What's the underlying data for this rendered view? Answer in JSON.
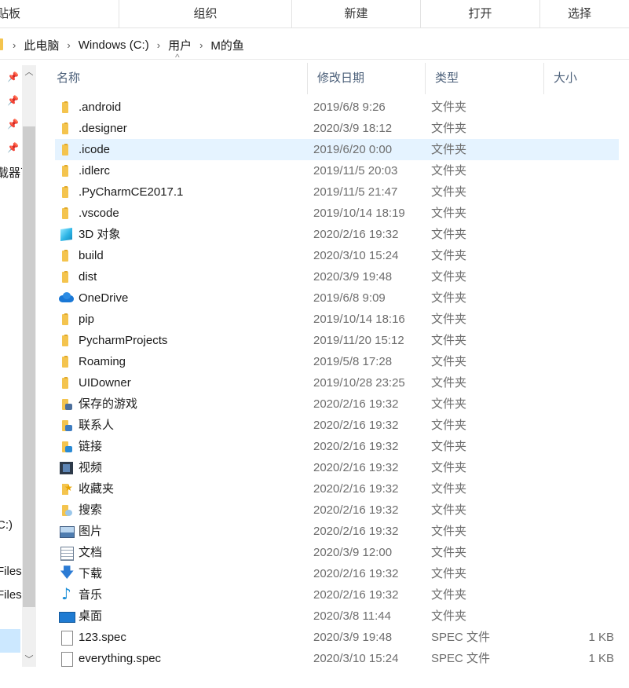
{
  "ribbon": {
    "groups": [
      "贴板",
      "组织",
      "新建",
      "打开",
      "选择"
    ]
  },
  "address": {
    "crumbs": [
      "此电脑",
      "Windows (C:)",
      "用户",
      "M的鱼"
    ]
  },
  "nav": {
    "partial_labels": [
      "载器丁",
      "C:)",
      "Files",
      "Files"
    ]
  },
  "headers": {
    "name": "名称",
    "date": "修改日期",
    "type": "类型",
    "size": "大小"
  },
  "rows": [
    {
      "name": ".android",
      "date": "2019/6/8 9:26",
      "type": "文件夹",
      "size": "",
      "icon": "folder-icon"
    },
    {
      "name": ".designer",
      "date": "2020/3/9 18:12",
      "type": "文件夹",
      "size": "",
      "icon": "folder-icon"
    },
    {
      "name": ".icode",
      "date": "2019/6/20 0:00",
      "type": "文件夹",
      "size": "",
      "icon": "folder-icon"
    },
    {
      "name": ".idlerc",
      "date": "2019/11/5 20:03",
      "type": "文件夹",
      "size": "",
      "icon": "folder-icon"
    },
    {
      "name": ".PyCharmCE2017.1",
      "date": "2019/11/5 21:47",
      "type": "文件夹",
      "size": "",
      "icon": "folder-icon"
    },
    {
      "name": ".vscode",
      "date": "2019/10/14 18:19",
      "type": "文件夹",
      "size": "",
      "icon": "folder-icon"
    },
    {
      "name": "3D 对象",
      "date": "2020/2/16 19:32",
      "type": "文件夹",
      "size": "",
      "icon": "3d-objects-icon"
    },
    {
      "name": "build",
      "date": "2020/3/10 15:24",
      "type": "文件夹",
      "size": "",
      "icon": "folder-icon"
    },
    {
      "name": "dist",
      "date": "2020/3/9 19:48",
      "type": "文件夹",
      "size": "",
      "icon": "folder-icon"
    },
    {
      "name": "OneDrive",
      "date": "2019/6/8 9:09",
      "type": "文件夹",
      "size": "",
      "icon": "onedrive-cloud-icon"
    },
    {
      "name": "pip",
      "date": "2019/10/14 18:16",
      "type": "文件夹",
      "size": "",
      "icon": "folder-icon"
    },
    {
      "name": "PycharmProjects",
      "date": "2019/11/20 15:12",
      "type": "文件夹",
      "size": "",
      "icon": "folder-icon"
    },
    {
      "name": "Roaming",
      "date": "2019/5/8 17:28",
      "type": "文件夹",
      "size": "",
      "icon": "folder-icon"
    },
    {
      "name": "UIDowner",
      "date": "2019/10/28 23:25",
      "type": "文件夹",
      "size": "",
      "icon": "folder-icon"
    },
    {
      "name": "保存的游戏",
      "date": "2020/2/16 19:32",
      "type": "文件夹",
      "size": "",
      "icon": "saved-games-icon"
    },
    {
      "name": "联系人",
      "date": "2020/2/16 19:32",
      "type": "文件夹",
      "size": "",
      "icon": "contacts-icon"
    },
    {
      "name": "链接",
      "date": "2020/2/16 19:32",
      "type": "文件夹",
      "size": "",
      "icon": "links-icon"
    },
    {
      "name": "视频",
      "date": "2020/2/16 19:32",
      "type": "文件夹",
      "size": "",
      "icon": "videos-icon"
    },
    {
      "name": "收藏夹",
      "date": "2020/2/16 19:32",
      "type": "文件夹",
      "size": "",
      "icon": "favorites-icon"
    },
    {
      "name": "搜索",
      "date": "2020/2/16 19:32",
      "type": "文件夹",
      "size": "",
      "icon": "searches-icon"
    },
    {
      "name": "图片",
      "date": "2020/2/16 19:32",
      "type": "文件夹",
      "size": "",
      "icon": "pictures-icon"
    },
    {
      "name": "文档",
      "date": "2020/3/9 12:00",
      "type": "文件夹",
      "size": "",
      "icon": "documents-icon"
    },
    {
      "name": "下载",
      "date": "2020/2/16 19:32",
      "type": "文件夹",
      "size": "",
      "icon": "downloads-icon"
    },
    {
      "name": "音乐",
      "date": "2020/2/16 19:32",
      "type": "文件夹",
      "size": "",
      "icon": "music-icon"
    },
    {
      "name": "桌面",
      "date": "2020/3/8 11:44",
      "type": "文件夹",
      "size": "",
      "icon": "desktop-icon"
    },
    {
      "name": "123.spec",
      "date": "2020/3/9 19:48",
      "type": "SPEC 文件",
      "size": "1 KB",
      "icon": "file-icon"
    },
    {
      "name": "everything.spec",
      "date": "2020/3/10 15:24",
      "type": "SPEC 文件",
      "size": "1 KB",
      "icon": "file-icon"
    }
  ],
  "hovered_row_index": 2,
  "colors": {
    "hover": "#e5f3ff",
    "selection": "#cce8ff",
    "folder": "#f4c44e",
    "header_text": "#4c607a"
  }
}
